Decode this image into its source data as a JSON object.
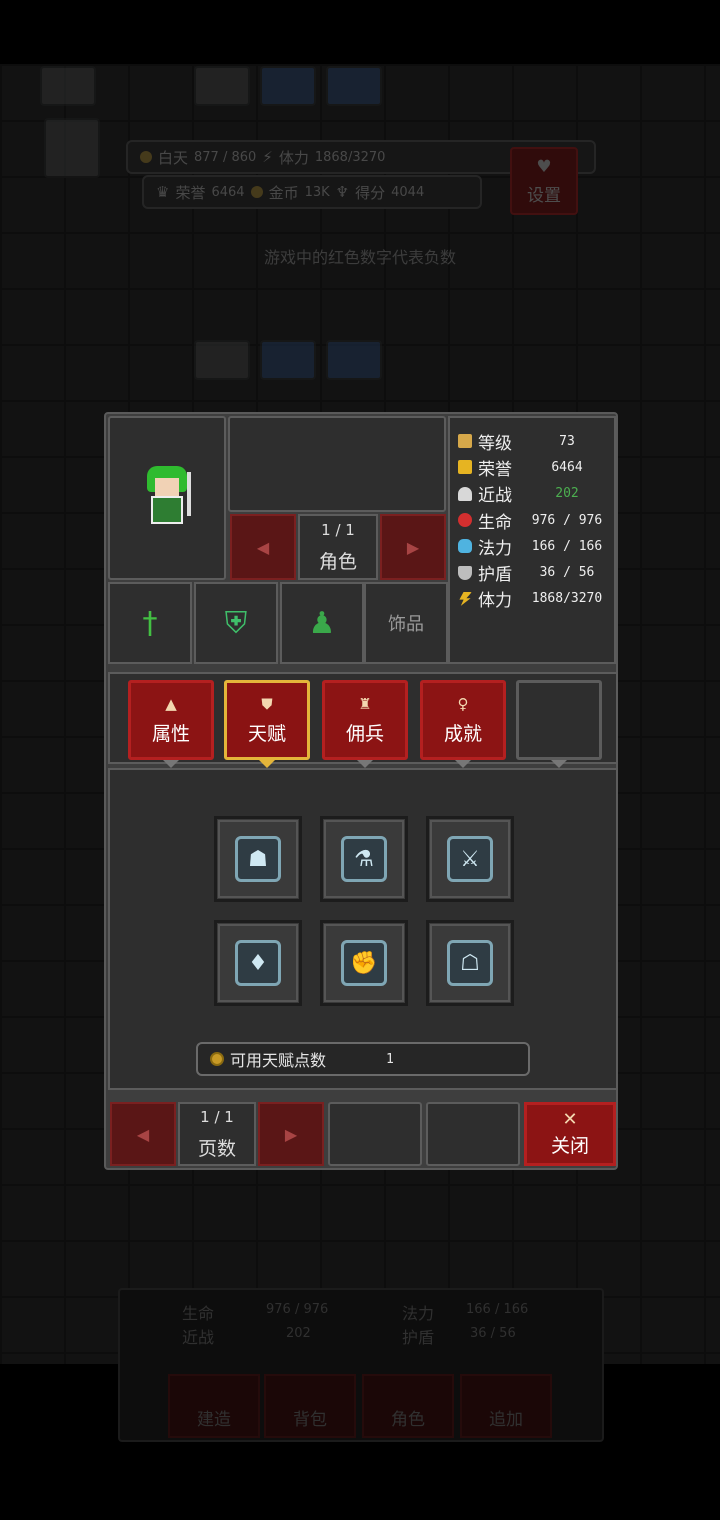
{
  "hud": {
    "day_label": "白天",
    "day_value": "877 / 860",
    "stamina_label": "体力",
    "stamina_value": "1868/3270",
    "honor_label": "荣誉",
    "honor_value": "6464",
    "gold_label": "金币",
    "gold_value": "13K",
    "score_label": "得分",
    "score_value": "4044",
    "settings_label": "设置",
    "hint": "游戏中的红色数字代表负数"
  },
  "character": {
    "page": "1 / 1",
    "page_label": "角色",
    "accessory_slot": "饰品"
  },
  "stats": [
    {
      "name": "等级",
      "value": "73",
      "color": "#d6a84a"
    },
    {
      "name": "荣誉",
      "value": "6464",
      "color": "#e6b422"
    },
    {
      "name": "近战",
      "value": "202",
      "color": "#d8d8d8",
      "value_color": "#4caf50"
    },
    {
      "name": "生命",
      "value": "976 / 976",
      "color": "#d32f2f"
    },
    {
      "name": "法力",
      "value": "166 / 166",
      "color": "#4fb3e0"
    },
    {
      "name": "护盾",
      "value": "36 / 56",
      "color": "#bdbdbd"
    },
    {
      "name": "体力",
      "value": "1868/3270",
      "color": "#e6b422"
    }
  ],
  "tabs": [
    {
      "label": "属性",
      "glyph": "▲"
    },
    {
      "label": "天赋",
      "glyph": "⛊"
    },
    {
      "label": "佣兵",
      "glyph": "♜"
    },
    {
      "label": "成就",
      "glyph": "♀"
    }
  ],
  "talents": [
    {
      "icon": "stone-face-icon",
      "glyph": "☗"
    },
    {
      "icon": "potion-flask-icon",
      "glyph": "⚗"
    },
    {
      "icon": "crossed-swords-icon",
      "glyph": "⚔"
    },
    {
      "icon": "spear-tip-icon",
      "glyph": "♦"
    },
    {
      "icon": "fist-icon",
      "glyph": "✊"
    },
    {
      "icon": "helmet-icon",
      "glyph": "☖"
    }
  ],
  "talent_points": {
    "label": "可用天赋点数",
    "value": "1"
  },
  "bottom": {
    "page": "1 / 1",
    "page_label": "页数",
    "close_label": "关闭"
  },
  "background_panel": {
    "hp_label": "生命",
    "hp_value": "976 / 976",
    "mana_label": "法力",
    "mana_value": "166 / 166",
    "melee_label": "近战",
    "melee_value": "202",
    "shield_label": "护盾",
    "shield_value": "36 / 56",
    "buttons": [
      "建造",
      "背包",
      "角色",
      "追加"
    ]
  }
}
